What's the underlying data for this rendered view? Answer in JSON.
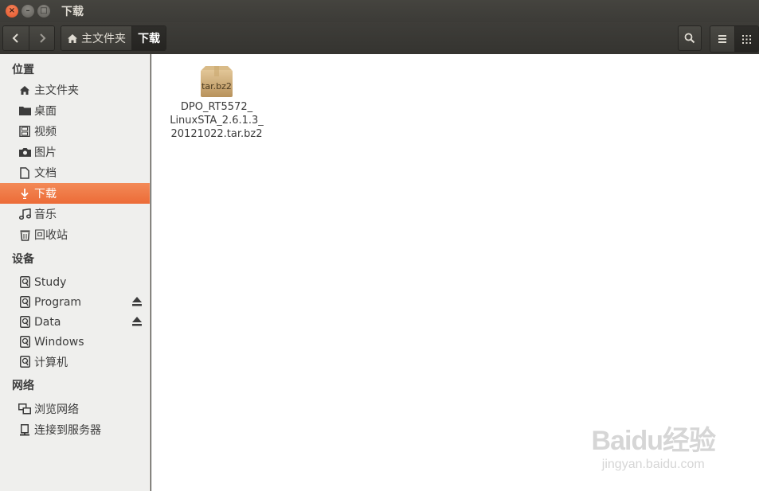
{
  "window": {
    "title": "下载",
    "close_glyph": "×",
    "min_glyph": "–",
    "max_glyph": "□"
  },
  "toolbar": {
    "breadcrumbs": [
      "主文件夹",
      "下载"
    ],
    "icons": [
      "back-icon",
      "forward-icon",
      "home-icon",
      "search-icon",
      "list-view-icon",
      "grid-view-icon"
    ]
  },
  "sidebar": {
    "places_header": "位置",
    "places": [
      {
        "label": "主文件夹",
        "icon": "home-icon"
      },
      {
        "label": "桌面",
        "icon": "folder-icon"
      },
      {
        "label": "视频",
        "icon": "film-icon"
      },
      {
        "label": "图片",
        "icon": "camera-icon"
      },
      {
        "label": "文档",
        "icon": "document-icon"
      },
      {
        "label": "下载",
        "icon": "download-icon",
        "selected": true
      },
      {
        "label": "音乐",
        "icon": "music-icon"
      },
      {
        "label": "回收站",
        "icon": "trash-icon"
      }
    ],
    "devices_header": "设备",
    "devices": [
      {
        "label": "Study",
        "icon": "drive-icon",
        "eject": false
      },
      {
        "label": "Program",
        "icon": "drive-icon",
        "eject": true
      },
      {
        "label": "Data",
        "icon": "drive-icon",
        "eject": true
      },
      {
        "label": "Windows",
        "icon": "drive-icon",
        "eject": false
      },
      {
        "label": "计算机",
        "icon": "drive-icon",
        "eject": false
      }
    ],
    "network_header": "网络",
    "network": [
      {
        "label": "浏览网络",
        "icon": "network-icon"
      },
      {
        "label": "连接到服务器",
        "icon": "server-icon"
      }
    ]
  },
  "content": {
    "files": [
      {
        "badge": "tar.bz2",
        "name_lines": [
          "DPO_RT5572_",
          "LinuxSTA_2.6.1.3_",
          "20121022.tar.bz2"
        ],
        "icon": "archive-icon"
      }
    ]
  },
  "watermark": {
    "logo": "Baidu经验",
    "url": "jingyan.baidu.com"
  },
  "colors": {
    "selection": "#ec6b37",
    "titlebar": "#3c3b37",
    "sidebar_bg": "#efefed",
    "close_button": "#e1542a"
  }
}
